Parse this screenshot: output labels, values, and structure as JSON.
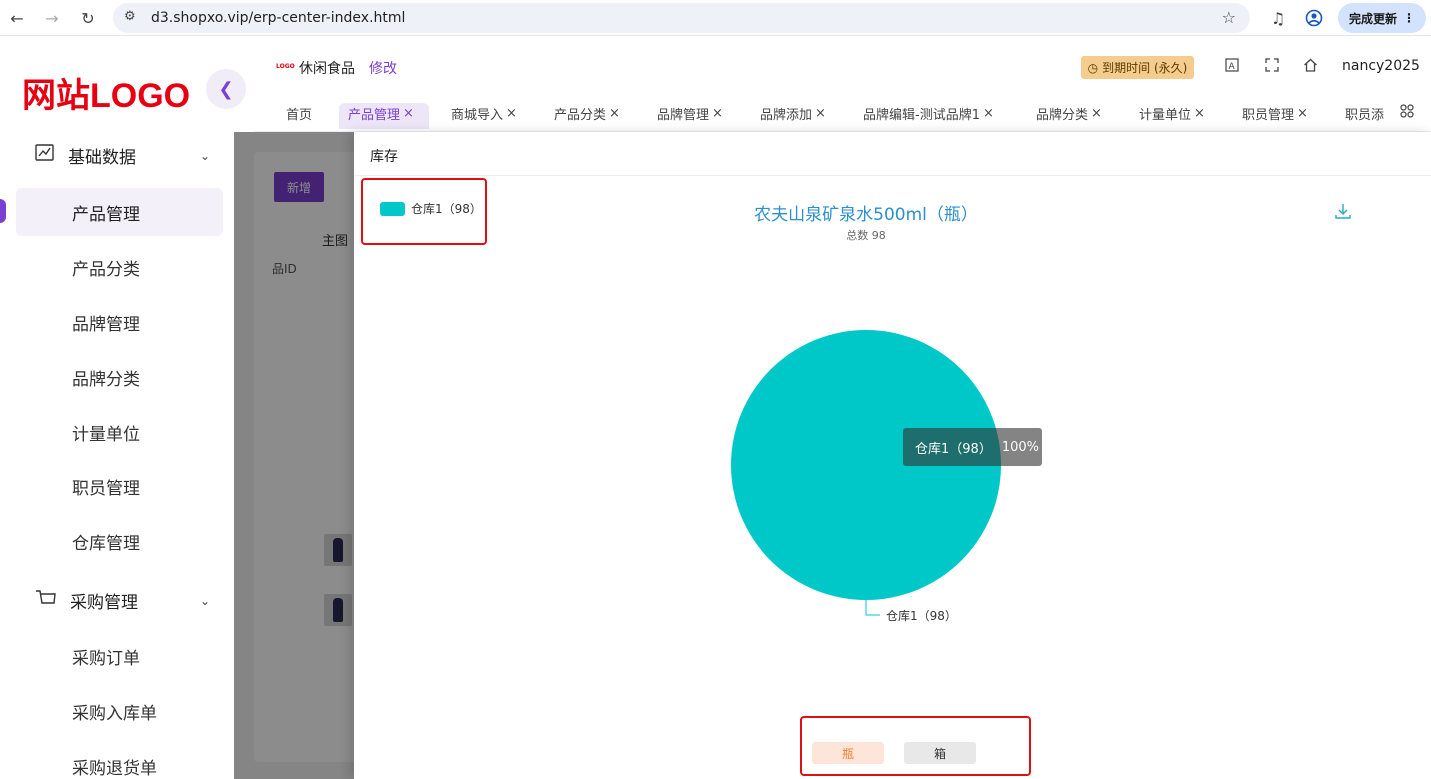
{
  "browser": {
    "url": "d3.shopxo.vip/erp-center-index.html",
    "update_label": "完成更新"
  },
  "sidebar": {
    "logo": "网站LOGO",
    "groups": [
      {
        "label": "基础数据"
      },
      {
        "label": "采购管理"
      }
    ],
    "items": [
      {
        "label": "产品管理"
      },
      {
        "label": "产品分类"
      },
      {
        "label": "品牌管理"
      },
      {
        "label": "品牌分类"
      },
      {
        "label": "计量单位"
      },
      {
        "label": "职员管理"
      },
      {
        "label": "仓库管理"
      },
      {
        "label": "采购订单"
      },
      {
        "label": "采购入库单"
      },
      {
        "label": "采购退货单"
      }
    ]
  },
  "header": {
    "store_logo": "LOGO",
    "store_name": "休闲食品",
    "edit_label": "修改",
    "expire_label": "到期时间 (永久)",
    "username": "nancy2025"
  },
  "tabs": [
    {
      "label": "首页"
    },
    {
      "label": "产品管理"
    },
    {
      "label": "商城导入"
    },
    {
      "label": "产品分类"
    },
    {
      "label": "品牌管理"
    },
    {
      "label": "品牌添加"
    },
    {
      "label": "品牌编辑-测试品牌1"
    },
    {
      "label": "品牌分类"
    },
    {
      "label": "计量单位"
    },
    {
      "label": "职员管理"
    },
    {
      "label": "职员添"
    }
  ],
  "main": {
    "add_label": "新增",
    "col_main_img": "主图",
    "col_id": "品ID"
  },
  "drawer": {
    "title": "库存",
    "unit_buttons": [
      "瓶",
      "箱"
    ]
  },
  "chart_data": {
    "type": "pie",
    "title": "农夫山泉矿泉水500ml（瓶）",
    "subtitle": "总数 98",
    "slices": [
      {
        "name": "仓库1（98）",
        "value": 98,
        "percent": "100%",
        "color": "#00c8c8"
      }
    ],
    "legend": {
      "label": "仓库1（98）",
      "placement": "top-left"
    },
    "tooltip": {
      "name": "仓库1（98）",
      "percent": "100%"
    },
    "slice_label": "仓库1（98）"
  }
}
